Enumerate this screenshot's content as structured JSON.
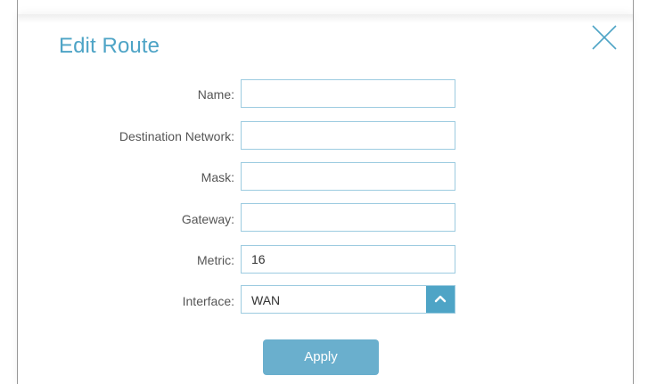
{
  "dialog": {
    "title": "Edit Route",
    "close_icon": "close-icon"
  },
  "form": {
    "name": {
      "label": "Name:",
      "value": ""
    },
    "destination_network": {
      "label": "Destination Network:",
      "value": ""
    },
    "mask": {
      "label": "Mask:",
      "value": ""
    },
    "gateway": {
      "label": "Gateway:",
      "value": ""
    },
    "metric": {
      "label": "Metric:",
      "value": "16"
    },
    "interface": {
      "label": "Interface:",
      "value": "WAN",
      "icon": "chevron-up-icon"
    }
  },
  "actions": {
    "apply_label": "Apply"
  },
  "colors": {
    "accent": "#4ea4c6",
    "button": "#6aafcd",
    "field_border": "#9ccbe0",
    "label_text": "#555555"
  }
}
